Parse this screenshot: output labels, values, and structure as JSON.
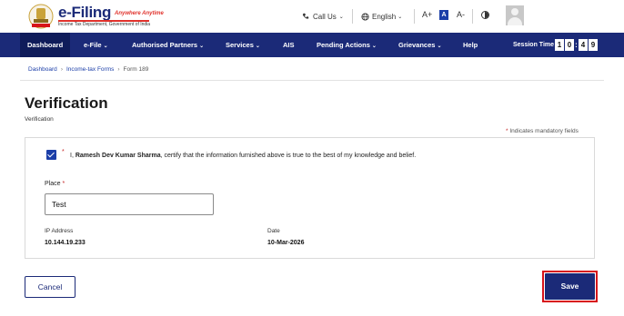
{
  "header": {
    "brand": "e-Filing",
    "brand_tagline": "Anywhere Anytime",
    "brand_sub": "Income Tax Department, Government of India",
    "call_us": "Call Us",
    "language": "English",
    "font_increase": "A+",
    "font_normal": "A",
    "font_decrease": "A-"
  },
  "nav": {
    "items": [
      "Dashboard",
      "e-File",
      "Authorised Partners",
      "Services",
      "AIS",
      "Pending Actions",
      "Grievances",
      "Help"
    ],
    "session_label": "Session Time",
    "session_digits": [
      "1",
      "0",
      ":",
      "4",
      "9"
    ]
  },
  "breadcrumb": {
    "items": [
      "Dashboard",
      "Income-tax Forms",
      "Form 189"
    ]
  },
  "page": {
    "title": "Verification",
    "subtitle": "Verification",
    "mandatory_note": "Indicates mandatory fields",
    "mandatory_star": "*"
  },
  "verification": {
    "checked": true,
    "cert_prefix": "I,",
    "name": "Ramesh Dev Kumar Sharma",
    "cert_suffix": ", certify that the information furnished above is true to the best of my knowledge and belief.",
    "place_label": "Place",
    "place_value": "Test",
    "ip_label": "IP Address",
    "ip_value": "10.144.19.233",
    "date_label": "Date",
    "date_value": "10-Mar-2026"
  },
  "actions": {
    "cancel": "Cancel",
    "save": "Save"
  },
  "colors": {
    "nav_bg": "#1b2a78",
    "accent": "#1b3ea8",
    "required": "#c62828",
    "highlight": "#d7141a"
  }
}
